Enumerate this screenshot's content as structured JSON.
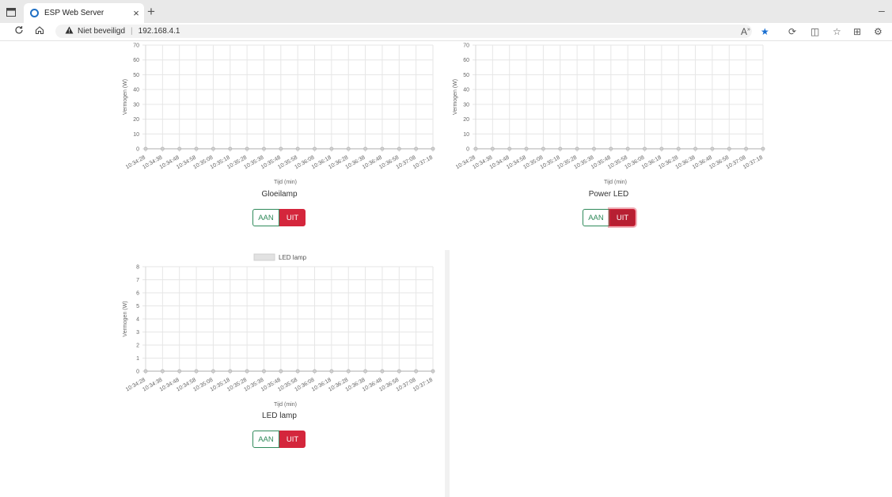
{
  "browser": {
    "tab_title": "ESP Web Server",
    "tab_close": "×",
    "new_tab": "+",
    "minimize": "–",
    "security_label": "Niet beveiligd",
    "url": "192.168.4.1",
    "icons": [
      "window-menu-icon",
      "refresh-icon",
      "home-icon",
      "warning-icon",
      "read-aloud-icon",
      "favorite-star-icon",
      "extensions-icon",
      "split-screen-icon",
      "favorites-icon",
      "collections-icon",
      "copilot-icon"
    ]
  },
  "charts": [
    {
      "title": "Gloeilamp",
      "ylabel": "Vermogen (W)",
      "xlabel": "Tijd (min)",
      "yticks": [
        "0",
        "10",
        "20",
        "30",
        "40",
        "50",
        "60",
        "70"
      ],
      "xticks": [
        "10:34:28",
        "10:34:38",
        "10:34:48",
        "10:34:58",
        "10:35:08",
        "10:35:18",
        "10:35:28",
        "10:35:38",
        "10:35:48",
        "10:35:58",
        "10:36:08",
        "10:36:18",
        "10:36:28",
        "10:36:38",
        "10:36:48",
        "10:36:58",
        "10:37:08",
        "10:37:18"
      ],
      "legend": "",
      "on_label": "AAN",
      "off_label": "UIT"
    },
    {
      "title": "Power LED",
      "ylabel": "Vermogen (W)",
      "xlabel": "Tijd (min)",
      "yticks": [
        "0",
        "10",
        "20",
        "30",
        "40",
        "50",
        "60",
        "70"
      ],
      "xticks": [
        "10:34:28",
        "10:34:38",
        "10:34:48",
        "10:34:58",
        "10:35:08",
        "10:35:18",
        "10:35:28",
        "10:35:38",
        "10:35:48",
        "10:35:58",
        "10:36:08",
        "10:36:18",
        "10:36:28",
        "10:36:38",
        "10:36:48",
        "10:36:58",
        "10:37:08",
        "10:37:18"
      ],
      "legend": "",
      "on_label": "AAN",
      "off_label": "UIT"
    },
    {
      "title": "LED lamp",
      "ylabel": "Vermogen (W)",
      "xlabel": "Tijd (min)",
      "yticks": [
        "0",
        "1",
        "2",
        "3",
        "4",
        "5",
        "6",
        "7",
        "8"
      ],
      "xticks": [
        "10:34:28",
        "10:34:38",
        "10:34:48",
        "10:34:58",
        "10:35:08",
        "10:35:18",
        "10:35:28",
        "10:35:38",
        "10:35:48",
        "10:35:58",
        "10:36:08",
        "10:36:18",
        "10:36:28",
        "10:36:38",
        "10:36:48",
        "10:36:58",
        "10:37:08",
        "10:37:18"
      ],
      "legend": "LED lamp",
      "on_label": "AAN",
      "off_label": "UIT"
    }
  ],
  "chart_data": [
    {
      "type": "line",
      "title": "Gloeilamp",
      "xlabel": "Tijd (min)",
      "ylabel": "Vermogen (W)",
      "ylim": [
        0,
        70
      ],
      "x": [
        "10:34:28",
        "10:34:38",
        "10:34:48",
        "10:34:58",
        "10:35:08",
        "10:35:18",
        "10:35:28",
        "10:35:38",
        "10:35:48",
        "10:35:58",
        "10:36:08",
        "10:36:18",
        "10:36:28",
        "10:36:38",
        "10:36:48",
        "10:36:58",
        "10:37:08",
        "10:37:18"
      ],
      "series": [
        {
          "values": [
            0,
            0,
            0,
            0,
            0,
            0,
            0,
            0,
            0,
            0,
            0,
            0,
            0,
            0,
            0,
            0,
            0,
            0
          ]
        }
      ],
      "grid": true
    },
    {
      "type": "line",
      "title": "Power LED",
      "xlabel": "Tijd (min)",
      "ylabel": "Vermogen (W)",
      "ylim": [
        0,
        70
      ],
      "x": [
        "10:34:28",
        "10:34:38",
        "10:34:48",
        "10:34:58",
        "10:35:08",
        "10:35:18",
        "10:35:28",
        "10:35:38",
        "10:35:48",
        "10:35:58",
        "10:36:08",
        "10:36:18",
        "10:36:28",
        "10:36:38",
        "10:36:48",
        "10:36:58",
        "10:37:08",
        "10:37:18"
      ],
      "series": [
        {
          "values": [
            0,
            0,
            0,
            0,
            0,
            0,
            0,
            0,
            0,
            0,
            0,
            0,
            0,
            0,
            0,
            0,
            0,
            0
          ]
        }
      ],
      "grid": true
    },
    {
      "type": "line",
      "title": "LED lamp",
      "xlabel": "Tijd (min)",
      "ylabel": "Vermogen (W)",
      "ylim": [
        0,
        8
      ],
      "x": [
        "10:34:28",
        "10:34:38",
        "10:34:48",
        "10:34:58",
        "10:35:08",
        "10:35:18",
        "10:35:28",
        "10:35:38",
        "10:35:48",
        "10:35:58",
        "10:36:08",
        "10:36:18",
        "10:36:28",
        "10:36:38",
        "10:36:48",
        "10:36:58",
        "10:37:08",
        "10:37:18"
      ],
      "series": [
        {
          "name": "LED lamp",
          "values": [
            0,
            0,
            0,
            0,
            0,
            0,
            0,
            0,
            0,
            0,
            0,
            0,
            0,
            0,
            0,
            0,
            0,
            0
          ]
        }
      ],
      "legend": "top",
      "grid": true
    }
  ]
}
